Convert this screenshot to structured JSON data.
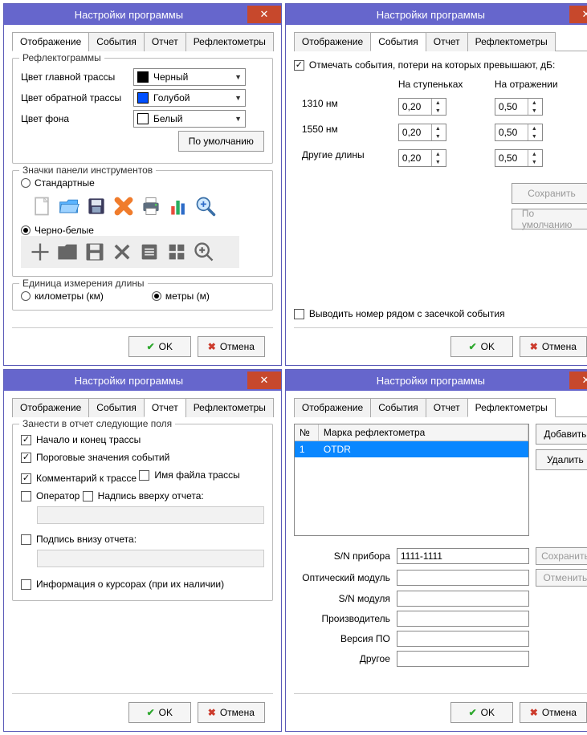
{
  "windowTitle": "Настройки программы",
  "tabs": {
    "display": "Отображение",
    "events": "События",
    "report": "Отчет",
    "refl": "Рефлектометры"
  },
  "buttons": {
    "ok": "OK",
    "cancel": "Отмена",
    "defaults": "По умолчанию",
    "save": "Сохранить",
    "add": "Добавить",
    "delete": "Удалить",
    "revert": "Отменить"
  },
  "win1": {
    "grp_refl": "Рефлектограммы",
    "lbl_main": "Цвет главной трассы",
    "lbl_back": "Цвет обратной трассы",
    "lbl_bg": "Цвет фона",
    "val_main": "Черный",
    "val_back": "Голубой",
    "val_bg": "Белый",
    "col_main": "#000000",
    "col_back": "#0050ff",
    "col_bg": "#ffffff",
    "grp_icons": "Значки панели инструментов",
    "opt_std": "Стандартные",
    "opt_bw": "Черно-белые",
    "grp_len": "Единица измерения длины",
    "opt_km": "километры (км)",
    "opt_m": "метры (м)"
  },
  "win2": {
    "chk_mark": "Отмечать события, потери на которых превышают, дБ:",
    "col_step": "На ступеньках",
    "col_refl": "На отражении",
    "r1": "1310 нм",
    "r2": "1550 нм",
    "r3": "Другие длины",
    "v_step": "0,20",
    "v_refl": "0,50",
    "chk_num": "Выводить номер рядом с засечкой события"
  },
  "win3": {
    "grp": "Занести в отчет следующие поля",
    "c1": "Начало и конец трассы",
    "c2": "Пороговые значения событий",
    "c3": "Комментарий к трассе",
    "c4": "Имя файла трассы",
    "c5": "Оператор",
    "c6": "Надпись вверху отчета:",
    "c7": "Подпись внизу отчета:",
    "c8": "Информация о курсорах (при их наличии)"
  },
  "win4": {
    "col_no": "№",
    "col_brand": "Марка рефлектометра",
    "row_no": "1",
    "row_brand": "OTDR",
    "f_sn_dev": "S/N прибора",
    "v_sn_dev": "1111-1111",
    "f_opt_mod": "Оптический модуль",
    "f_sn_mod": "S/N модуля",
    "f_manuf": "Производитель",
    "f_ver": "Версия ПО",
    "f_other": "Другое"
  }
}
